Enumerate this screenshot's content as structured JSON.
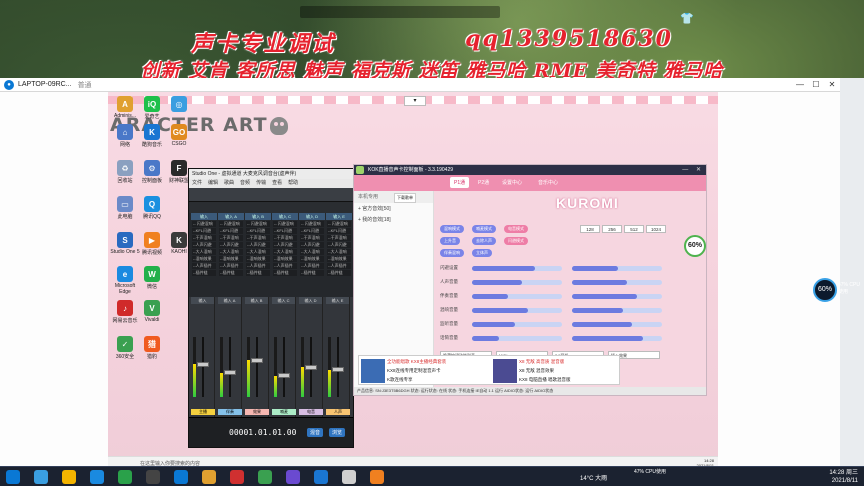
{
  "banner": {
    "title": "声卡专业调试",
    "qq": "qq1339518630",
    "brands": "创新 艾肯 客所思 魅声 福克斯 迷笛 雅马哈 RME 美奇特 雅马哈"
  },
  "remote": {
    "window_title": "LAPTOP-09RC...",
    "window_sub": "普通",
    "controls": [
      "—",
      "☐",
      "✕"
    ],
    "dropdown": "▾"
  },
  "inner_desktop": {
    "character_art": "ARACTER ART",
    "icons": [
      {
        "label": "Adminis...",
        "color": "#e0a030",
        "glyph": "A"
      },
      {
        "label": "爱奇艺",
        "color": "#1ec04a",
        "glyph": "iQ"
      },
      {
        "label": "",
        "color": "#3a9ee0",
        "glyph": "◎"
      },
      {
        "label": "网络",
        "color": "#4a78c8",
        "glyph": "⌂"
      },
      {
        "label": "酷狗音乐",
        "color": "#1a76d2",
        "glyph": "K"
      },
      {
        "label": "CSGO",
        "color": "#e08a20",
        "glyph": "GO"
      },
      {
        "label": "回收站",
        "color": "#8aa0c0",
        "glyph": "♻"
      },
      {
        "label": "控制面板",
        "color": "#4a78c8",
        "glyph": "⚙"
      },
      {
        "label": "财神联盟",
        "color": "#2a2a2a",
        "glyph": "F"
      },
      {
        "label": "此电脑",
        "color": "#6a8ac8",
        "glyph": "▭"
      },
      {
        "label": "腾讯QQ",
        "color": "#1a90e0",
        "glyph": "Q"
      },
      {
        "label": "Studio One 5",
        "color": "#2a6ac0",
        "glyph": "S"
      },
      {
        "label": "腾讯视频",
        "color": "#f08020",
        "glyph": "▶"
      },
      {
        "label": "KAOHI",
        "color": "#3a3a3a",
        "glyph": "K"
      },
      {
        "label": "Microsoft Edge",
        "color": "#1a8ae0",
        "glyph": "e"
      },
      {
        "label": "微信",
        "color": "#22b04a",
        "glyph": "W"
      },
      {
        "label": "网易云音乐",
        "color": "#d02a2a",
        "glyph": "♪"
      },
      {
        "label": "Vivaldi",
        "color": "#3aa050",
        "glyph": "V"
      },
      {
        "label": "360安全",
        "color": "#3aa050",
        "glyph": "✓"
      },
      {
        "label": "猎豹",
        "color": "#f05a20",
        "glyph": "猎"
      }
    ]
  },
  "studio_one": {
    "title": "Studio One - 虚拟通道 大麦克风调音台(虚声伴)",
    "menu": [
      "文件",
      "编辑",
      "歌曲",
      "音频",
      "传输",
      "查看",
      "帮助"
    ],
    "track_headers": [
      "输入",
      "输入 A",
      "输入 B",
      "输入 C",
      "输入 D",
      "输入 E"
    ],
    "track_rows": [
      "-- 闪避混响",
      "--KFL闪避",
      "--干声混响",
      "--人声闪避",
      "--大人混响",
      "--混响效果",
      "--人声插件",
      "--插件链"
    ],
    "fader_names": [
      "主播",
      "伴奏",
      "效果",
      "喊麦",
      "电音",
      "人声"
    ],
    "fader_levels": [
      0.55,
      0.4,
      0.62,
      0.35,
      0.5,
      0.45
    ],
    "time": "00001.01.01.00",
    "tempo": "120.00",
    "buttons": [
      "混音",
      "浏览"
    ]
  },
  "sound_panel": {
    "title": "KOK直播音声卡控制面板 - 3.3.190429",
    "tabs": [
      "P1通",
      "P2通",
      "设置中心",
      "音乐中心"
    ],
    "left_head": "本机专用",
    "left_btn": "下载歌单",
    "left_items": [
      "+ 官方音效[50]",
      "+ 我的音效[18]"
    ],
    "brand": "KUROMI",
    "pills": [
      "混响模式",
      "喊麦模式",
      "电音模式",
      "上升音",
      "去除人声",
      "闪避模式",
      "伴奏混响",
      "立体声"
    ],
    "values": [
      "128",
      "256",
      "512",
      "1024"
    ],
    "labels": [
      "闪避设置",
      "人声音量",
      "伴奏音量",
      "混响音量",
      "监听音量",
      "话筒音量"
    ],
    "slider_levels": [
      0.7,
      0.55,
      0.4,
      0.62,
      0.48,
      0.3
    ],
    "gauge_value": "60%",
    "list_items": [
      "隐藏按键功能列表",
      "MIDI",
      "3.5耳机",
      "插入效果"
    ],
    "ads": [
      "全功能唱歌 KX8主播经典套装",
      "KX8连线专用定制混音声卡",
      "K歌连线专享",
      "X8 无敌 高音质 混音版",
      "X8 无敌 混音效果",
      "KX8 电脑直播 唱歌混音版"
    ],
    "ad_price": "0",
    "status": "产品信息: SN:J3E3T5B6DGH 状态: 运行状态: 在线 状态: 手机连接 IE自动 1.1 运行 AIDIO状态: 运行 AIDIO状态"
  },
  "inner_taskbar": {
    "search": "在这里输入你要搜索的内容",
    "time": "14:28",
    "date": "2021/8/11"
  },
  "host_taskbar": {
    "weather": "14°C 大雨",
    "cpu": "47% CPU使用",
    "time": "14:28 周三",
    "date": "2021/8/11"
  },
  "overlay": {
    "cpu_ring": "60%",
    "cpu_side": "47% CPU使用"
  }
}
